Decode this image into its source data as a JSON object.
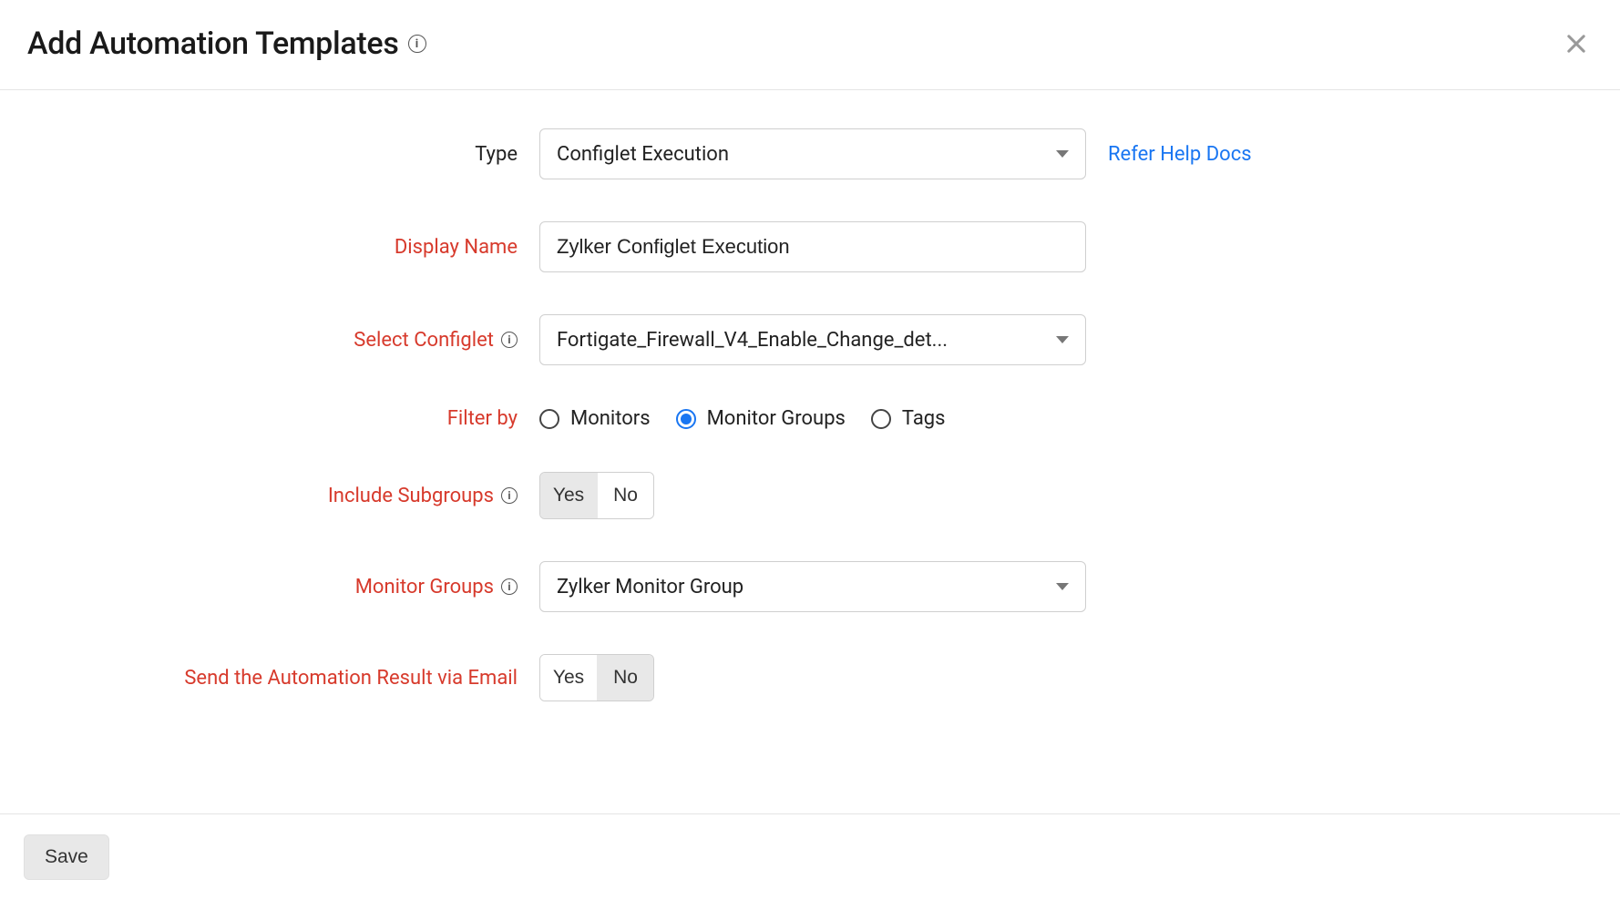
{
  "header": {
    "title": "Add Automation Templates"
  },
  "helpLink": "Refer Help Docs",
  "form": {
    "type": {
      "label": "Type",
      "value": "Configlet Execution"
    },
    "displayName": {
      "label": "Display Name",
      "value": "Zylker Configlet Execution"
    },
    "selectConfiglet": {
      "label": "Select Configlet",
      "value": "Fortigate_Firewall_V4_Enable_Change_det..."
    },
    "filterBy": {
      "label": "Filter by",
      "options": {
        "monitors": "Monitors",
        "monitorGroups": "Monitor Groups",
        "tags": "Tags"
      },
      "selected": "monitorGroups"
    },
    "includeSubgroups": {
      "label": "Include Subgroups",
      "yes": "Yes",
      "no": "No",
      "value": "yes"
    },
    "monitorGroups": {
      "label": "Monitor Groups",
      "value": "Zylker Monitor Group"
    },
    "sendEmail": {
      "label": "Send the Automation Result via Email",
      "yes": "Yes",
      "no": "No",
      "value": "no"
    }
  },
  "footer": {
    "save": "Save"
  }
}
